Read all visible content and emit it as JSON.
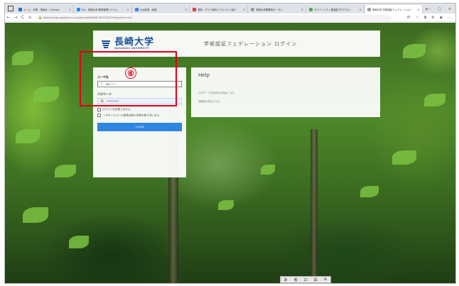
{
  "browser": {
    "tabs": [
      {
        "label": "メール - 沢塚 - 長崎大 - Outlook",
        "color": "#1e6fd0"
      },
      {
        "label": "Top - 長崎大学 教務管理システム",
        "color": "#1e90ff"
      },
      {
        "label": "九州経済 - 地図",
        "color": "#3b82f6"
      },
      {
        "label": "差別・ダイヤ案内とアルバイト紹介",
        "color": "#e53935"
      },
      {
        "label": "長崎大学教職員ポータル",
        "color": "#9e9e9e"
      },
      {
        "label": "ダイバーシティ推進室プログラム",
        "color": "#4caf50"
      },
      {
        "label": "長崎大学 学術認証フェデレーション",
        "color": "#9e9e9e"
      }
    ],
    "new_tab": "+",
    "window_controls": [
      "–",
      "□",
      "×"
    ],
    "nav": {
      "back": "←",
      "forward": "→",
      "reload": "C",
      "home": "⌂"
    },
    "url": "https://nuidp.nagasaki-u.ac.jp/idp/profile/SAML2/POST/SSO?execution=e1s1"
  },
  "header": {
    "logo_jp": "長崎大学",
    "logo_en": "NAGASAKI UNIVERSITY",
    "title": "学術認証フェデレーション ログイン"
  },
  "login": {
    "username_label": "ユーザ名",
    "username_value": "aa-------",
    "password_label": "パスワード",
    "password_value": "•••••••",
    "remember_label": "ログインを記憶しません。",
    "consent_text": "このサービスへの属性送信の同意を取り消します。",
    "button_label": "LOGIN"
  },
  "annotation": {
    "number": "⑥"
  },
  "help": {
    "title": "Help",
    "links": [
      "パスワードをお忘れの方はこちら",
      "お問合せ先はこちら"
    ]
  },
  "ime_bar": [
    "あ",
    "者",
    "口",
    "段",
    "⚙"
  ]
}
